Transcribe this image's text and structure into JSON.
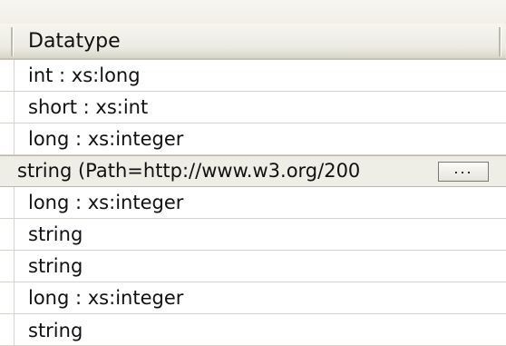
{
  "header": {
    "column_label": "Datatype"
  },
  "rows": [
    {
      "text": "int : xs:long"
    },
    {
      "text": "short : xs:int"
    },
    {
      "text": "long : xs:integer"
    },
    {
      "text": "string (Path=http://www.w3.org/200"
    },
    {
      "text": "long : xs:integer"
    },
    {
      "text": "string"
    },
    {
      "text": "string"
    },
    {
      "text": "long : xs:integer"
    },
    {
      "text": "string"
    }
  ],
  "ellipsis_button": {
    "label": "..."
  }
}
